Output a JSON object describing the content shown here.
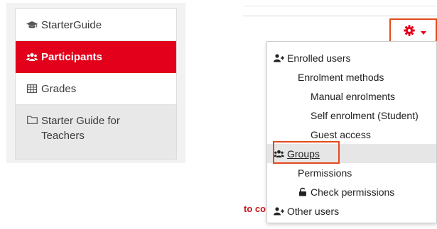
{
  "nav": {
    "items": [
      {
        "label": "StarterGuide",
        "icon": "graduation-cap-icon"
      },
      {
        "label": "Participants",
        "icon": "users-icon",
        "active": true
      },
      {
        "label": "Grades",
        "icon": "table-icon"
      },
      {
        "label": "Starter Guide for Teachers",
        "icon": "folder-icon"
      }
    ]
  },
  "actions": {
    "gear_icon": "gear-icon",
    "accent_color": "#e2001a",
    "highlight_color": "#e34b1d"
  },
  "menu": {
    "items": [
      {
        "label": "Enrolled users",
        "icon": "user-plus-icon"
      },
      {
        "label": "Enrolment methods"
      },
      {
        "label": "Manual enrolments"
      },
      {
        "label": "Self enrolment (Student)"
      },
      {
        "label": "Guest access"
      },
      {
        "label": "Groups",
        "icon": "users-icon",
        "active": true
      },
      {
        "label": "Permissions"
      },
      {
        "label": "Check permissions",
        "icon": "unlock-icon"
      },
      {
        "label": "Other users",
        "icon": "user-plus-icon"
      }
    ]
  },
  "page": {
    "partial_text": "to continue"
  }
}
